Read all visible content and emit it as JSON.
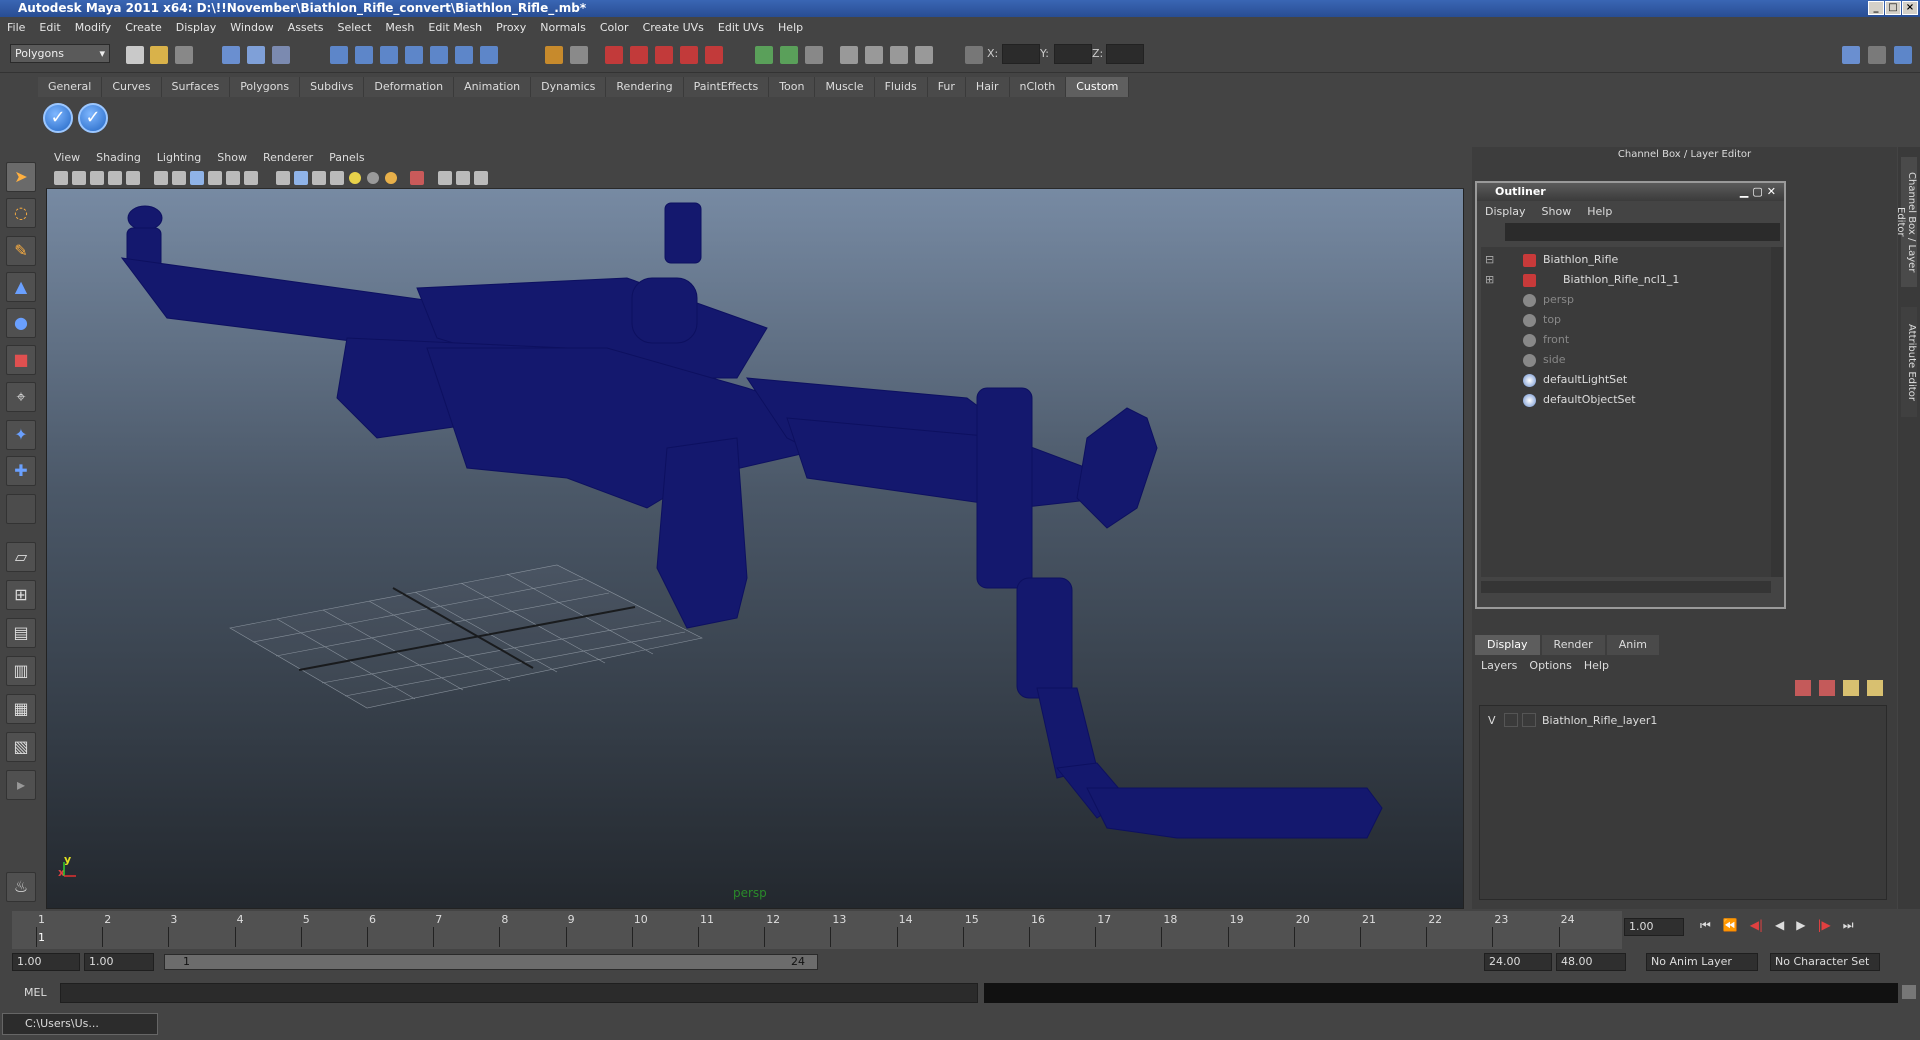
{
  "window": {
    "title": "Autodesk Maya 2011 x64: D:\\!!November\\Biathlon_Rifle_convert\\Biathlon_Rifle_.mb*"
  },
  "menubar": [
    "File",
    "Edit",
    "Modify",
    "Create",
    "Display",
    "Window",
    "Assets",
    "Select",
    "Mesh",
    "Edit Mesh",
    "Proxy",
    "Normals",
    "Color",
    "Create UVs",
    "Edit UVs",
    "Help"
  ],
  "statusline": {
    "mode": "Polygons",
    "x_label": "X:",
    "y_label": "Y:",
    "z_label": "Z:"
  },
  "shelf": {
    "tabs": [
      "General",
      "Curves",
      "Surfaces",
      "Polygons",
      "Subdivs",
      "Deformation",
      "Animation",
      "Dynamics",
      "Rendering",
      "PaintEffects",
      "Toon",
      "Muscle",
      "Fluids",
      "Fur",
      "Hair",
      "nCloth",
      "Custom"
    ],
    "active_tab": "Custom"
  },
  "viewport": {
    "menu": [
      "View",
      "Shading",
      "Lighting",
      "Show",
      "Renderer",
      "Panels"
    ],
    "camera_label": "persp",
    "axis_x": "x",
    "axis_y": "y"
  },
  "right_panel": {
    "title": "Channel Box / Layer Editor",
    "side_tabs": [
      "Channel Box / Layer Editor",
      "Attribute Editor"
    ]
  },
  "outliner": {
    "title": "Outliner",
    "menu": [
      "Display",
      "Show",
      "Help"
    ],
    "items": [
      {
        "label": "Biathlon_Rifle",
        "dim": false
      },
      {
        "label": "Biathlon_Rifle_ncl1_1",
        "dim": false
      },
      {
        "label": "persp",
        "dim": true
      },
      {
        "label": "top",
        "dim": true
      },
      {
        "label": "front",
        "dim": true
      },
      {
        "label": "side",
        "dim": true
      },
      {
        "label": "defaultLightSet",
        "dim": false
      },
      {
        "label": "defaultObjectSet",
        "dim": false
      }
    ]
  },
  "layer_editor": {
    "tabs": [
      "Display",
      "Render",
      "Anim"
    ],
    "active_tab": "Display",
    "menu": [
      "Layers",
      "Options",
      "Help"
    ],
    "layers": [
      {
        "visible": "V",
        "name": "Biathlon_Rifle_layer1"
      }
    ]
  },
  "time_slider": {
    "ticks": [
      "1",
      "2",
      "3",
      "4",
      "5",
      "6",
      "7",
      "8",
      "9",
      "10",
      "11",
      "12",
      "13",
      "14",
      "15",
      "16",
      "17",
      "18",
      "19",
      "20",
      "21",
      "22",
      "23",
      "24"
    ],
    "current_time": "1.00",
    "current_frame_marker": "1"
  },
  "range_slider": {
    "start_time": "1.00",
    "playback_start": "1.00",
    "range_start": "1",
    "range_end": "24",
    "playback_end": "24.00",
    "end_time": "48.00",
    "anim_layer": "No Anim Layer",
    "character_set": "No Character Set"
  },
  "command_line": {
    "label": "MEL"
  },
  "taskbar": {
    "item": "C:\\Users\\Us..."
  }
}
